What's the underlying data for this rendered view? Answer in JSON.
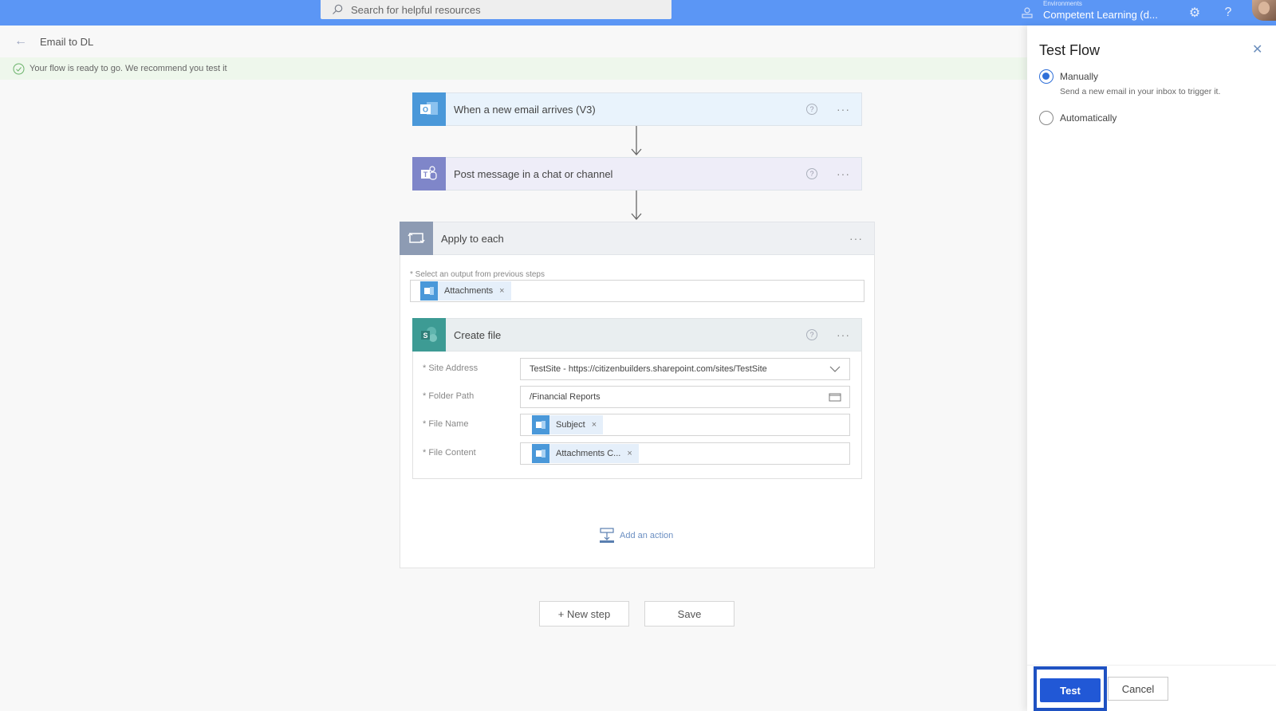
{
  "topbar": {
    "search_placeholder": "Search for helpful resources",
    "environment_label": "Environments",
    "environment_name": "Competent Learning (d...",
    "icons": [
      "environment-icon",
      "settings-icon",
      "help-icon",
      "avatar"
    ]
  },
  "header": {
    "flow_title": "Email to DL",
    "banner_text": "Your flow is ready to go. We recommend you test it"
  },
  "steps": {
    "trigger": {
      "label": "When a new email arrives (V3)",
      "icon": "outlook-icon",
      "color": "#4a98d9",
      "bg": "#e9f3fc"
    },
    "teams": {
      "label": "Post message in a chat or channel",
      "icon": "teams-icon",
      "color": "#7f86c9",
      "bg": "#eeedf8"
    },
    "loop": {
      "label": "Apply to each",
      "icon": "loop-icon",
      "color": "#8d9bb3",
      "bg": "#eef0f3",
      "select_label": "* Select an output from previous steps",
      "token": "Attachments"
    },
    "create_file": {
      "label": "Create file",
      "icon": "sharepoint-icon",
      "color": "#3d9b94",
      "bg": "#e9eef0",
      "fields": [
        {
          "label": "* Site Address",
          "value": "TestSite - https://citizenbuilders.sharepoint.com/sites/TestSite",
          "type": "dropdown"
        },
        {
          "label": "* Folder Path",
          "value": "/Financial Reports",
          "type": "folder"
        },
        {
          "label": "* File Name",
          "token": "Subject",
          "type": "token"
        },
        {
          "label": "* File Content",
          "token": "Attachments C...",
          "type": "token"
        }
      ]
    },
    "add_action": "Add an action"
  },
  "actions": {
    "new_step": "+ New step",
    "save": "Save"
  },
  "panel": {
    "title": "Test Flow",
    "options": [
      {
        "label": "Manually",
        "description": "Send a new email in your inbox to trigger it.",
        "selected": true
      },
      {
        "label": "Automatically",
        "selected": false
      }
    ],
    "test_button": "Test",
    "cancel_button": "Cancel"
  },
  "colors": {
    "topbar": "#5b96f5",
    "primary": "#2158d6",
    "highlight_frame": "#1f52c2"
  }
}
